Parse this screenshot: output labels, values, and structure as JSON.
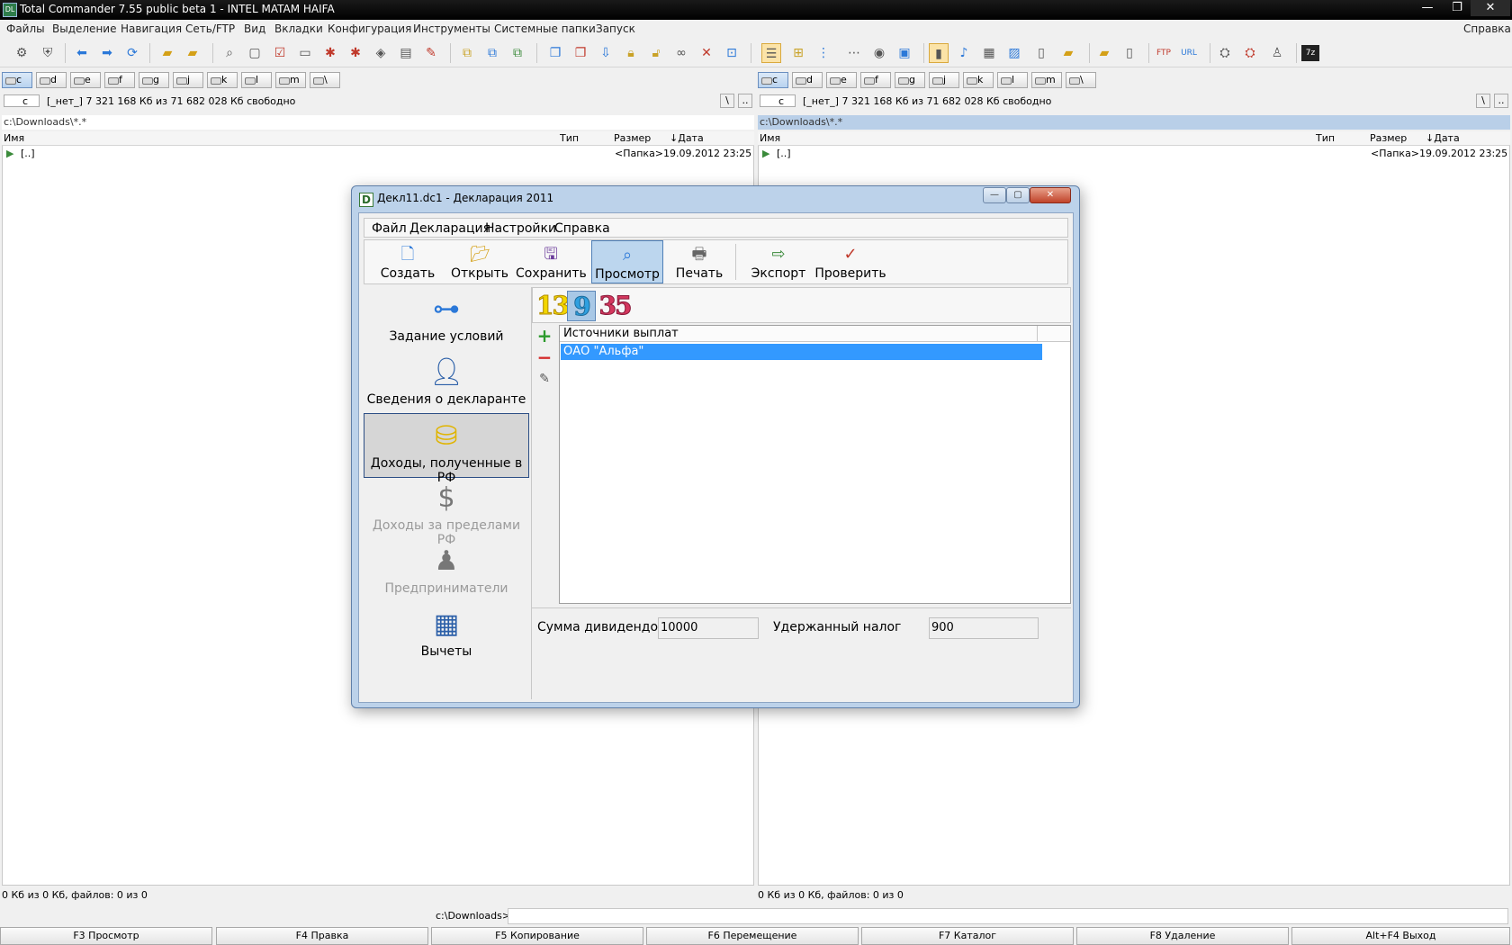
{
  "window": {
    "title": "Total Commander 7.55 public beta 1 - INTEL MATAM HAIFA",
    "app_icon": "DL",
    "buttons": [
      "—",
      "❐",
      "✕"
    ]
  },
  "menubar": {
    "items": [
      "Файлы",
      "Выделение",
      "Навигация",
      "Сеть/FTP",
      "Вид",
      "Вкладки",
      "Конфигурация",
      "Инструменты",
      "Системные папки",
      "Запуск"
    ],
    "help": "Справка"
  },
  "drives": [
    "c",
    "d",
    "e",
    "f",
    "g",
    "j",
    "k",
    "l",
    "m",
    "\\"
  ],
  "left_panel": {
    "drive": "c",
    "info": "[_нет_]  7 321 168 Кб из 71 682 028 Кб свободно",
    "path": "c:\\Downloads\\*.*",
    "columns": {
      "name": "Имя",
      "type": "Тип",
      "size": "Размер",
      "date": "Дата"
    },
    "rows": [
      {
        "name": "[..]",
        "size": "<Папка>",
        "date": "19.09.2012 23:25"
      }
    ],
    "status": "0 Кб из 0 Кб, файлов: 0 из 0"
  },
  "right_panel": {
    "drive": "c",
    "info": "[_нет_]  7 321 168 Кб из 71 682 028 Кб свободно",
    "path": "c:\\Downloads\\*.*",
    "columns": {
      "name": "Имя",
      "type": "Тип",
      "size": "Размер",
      "date": "Дата"
    },
    "rows": [
      {
        "name": "[..]",
        "size": "<Папка>",
        "date": "19.09.2012 23:25"
      }
    ],
    "status": "0 Кб из 0 Кб, файлов: 0 из 0"
  },
  "cmdline": {
    "prompt": "c:\\Downloads>"
  },
  "fkeys": [
    "F3 Просмотр",
    "F4 Правка",
    "F5 Копирование",
    "F6 Перемещение",
    "F7 Каталог",
    "F8 Удаление",
    "Alt+F4 Выход"
  ],
  "dialog": {
    "title": "Декл11.dc1 - Декларация 2011",
    "icon": "D",
    "menu": [
      "Файл",
      "Декларация",
      "Настройки",
      "Справка"
    ],
    "toolbar": [
      {
        "label": "Создать",
        "icon": "new-document-icon"
      },
      {
        "label": "Открыть",
        "icon": "open-folder-icon"
      },
      {
        "label": "Сохранить",
        "icon": "save-disk-icon"
      },
      {
        "label": "Просмотр",
        "icon": "preview-icon"
      },
      {
        "label": "Печать",
        "icon": "printer-icon"
      },
      {
        "label": "Экспорт",
        "icon": "export-icon"
      },
      {
        "label": "Проверить",
        "icon": "check-document-icon"
      }
    ],
    "nav": [
      {
        "label": "Задание условий",
        "icon": "conditions-tree-icon"
      },
      {
        "label": "Сведения о декларанте",
        "icon": "person-icon"
      },
      {
        "label": "Доходы, полученные в РФ",
        "icon": "coins-icon"
      },
      {
        "label": "Доходы за пределами РФ",
        "icon": "money-bag-icon"
      },
      {
        "label": "Предприниматели",
        "icon": "businessman-icon"
      },
      {
        "label": "Вычеты",
        "icon": "calculator-icon"
      }
    ],
    "tabs": [
      "13",
      "9",
      "35"
    ],
    "table": {
      "header": "Источники выплат",
      "rows": [
        "ОАО \"Альфа\""
      ]
    },
    "fields": {
      "dividends_label": "Сумма дивидендов",
      "dividends_value": "10000",
      "tax_label": "Удержанный налог",
      "tax_value": "900"
    }
  }
}
